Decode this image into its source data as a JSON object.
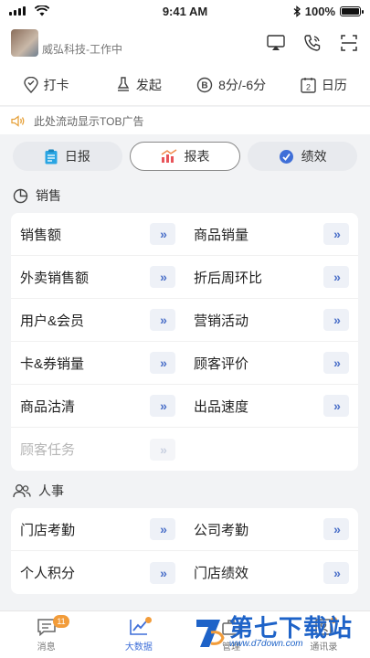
{
  "status": {
    "time": "9:41 AM",
    "battery": "100%",
    "battery_level": 1.0
  },
  "header": {
    "company": "威弘科技-工作中"
  },
  "quick": [
    {
      "label": "打卡",
      "icon": "location-pin-icon"
    },
    {
      "label": "发起",
      "icon": "stamp-icon"
    },
    {
      "label": "8分/-6分",
      "icon": "b-coin-icon"
    },
    {
      "label": "日历",
      "icon": "calendar-icon"
    }
  ],
  "calendar_day": "2",
  "ad": {
    "text": "此处流动显示TOB广告"
  },
  "tabs": [
    {
      "label": "日报",
      "active": false
    },
    {
      "label": "报表",
      "active": true
    },
    {
      "label": "绩效",
      "active": false
    }
  ],
  "sections": {
    "sales": {
      "title": "销售",
      "rows": [
        [
          "销售额",
          "商品销量"
        ],
        [
          "外卖销售额",
          "折后周环比"
        ],
        [
          "用户&会员",
          "营销活动"
        ],
        [
          "卡&券销量",
          "顾客评价"
        ],
        [
          "商品沽清",
          "出品速度"
        ],
        [
          "顾客任务"
        ]
      ]
    },
    "hr": {
      "title": "人事",
      "rows": [
        [
          "门店考勤",
          "公司考勤"
        ],
        [
          "个人积分",
          "门店绩效"
        ]
      ]
    }
  },
  "arrow_glyph": "»",
  "nav": [
    {
      "label": "消息",
      "badge": "11"
    },
    {
      "label": "大数据",
      "dot": true
    },
    {
      "label": "管理"
    },
    {
      "label": "通讯录",
      "dot": true
    }
  ],
  "watermark": {
    "main": "第七下载站",
    "sub": "www.d7down.com"
  },
  "colors": {
    "accent": "#3f6fd8",
    "badge": "#f29c3a",
    "arrow": "#4a6fc8"
  }
}
